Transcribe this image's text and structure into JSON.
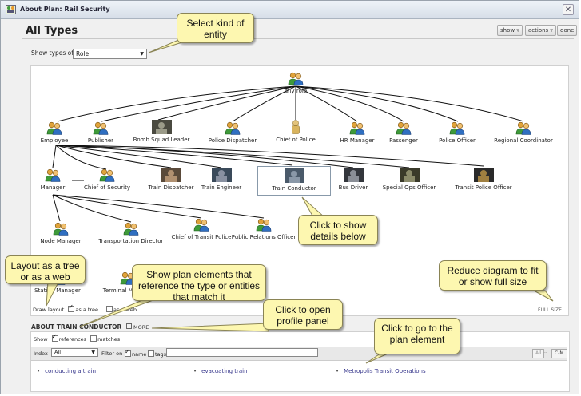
{
  "window": {
    "title": "About Plan: Rail Security",
    "close_glyph": "✕"
  },
  "panel": {
    "title": "All Types"
  },
  "toolbar": {
    "show_label": "show ▿",
    "actions_label": "actions ▿",
    "done_label": "done"
  },
  "types_filter": {
    "label": "Show types of",
    "value": "Role",
    "arrow": "▼"
  },
  "diagram": {
    "nodes": {
      "any_role": "any role",
      "employee": "Employee",
      "publisher": "Publisher",
      "bomb_squad": "Bomb Squad Leader",
      "police_dispatcher": "Police Dispatcher",
      "chief_of_police": "Chief of Police",
      "hr_manager": "HR Manager",
      "passenger": "Passenger",
      "police_officer": "Police Officer",
      "regional_coordinator": "Regional Coordinator",
      "manager": "Manager",
      "chief_of_security": "Chief of Security",
      "train_dispatcher": "Train Dispatcher",
      "train_engineer": "Train Engineer",
      "train_conductor": "Train Conductor",
      "bus_driver": "Bus Driver",
      "special_ops": "Special Ops Officer",
      "transit_police": "Transit Police Officer",
      "node_manager": "Node Manager",
      "transportation_director": "Transportation Director",
      "chief_transit_police": "Chief of Transit Police",
      "public_relations": "Public Relations Officer",
      "station_manager": "Station Manager",
      "terminal_manager": "Terminal Manager"
    },
    "layout_label": "Draw layout",
    "as_tree": "as a tree",
    "as_web": "as a web",
    "full_size": "FULL SIZE"
  },
  "about": {
    "heading": "ABOUT TRAIN CONDUCTOR",
    "more": "MORE",
    "show_label": "Show",
    "references": "references",
    "matches": "matches",
    "index_label": "Index",
    "index_value": "All",
    "filter_label": "Filter on",
    "name_label": "name",
    "tags_label": "tags",
    "filter_input": "",
    "alpha_all": "All",
    "alpha_dash": "--",
    "alpha_range": "C-M",
    "results": [
      "conducting a train",
      "evacuating train",
      "Metropolis Transit Operations"
    ]
  },
  "callouts": {
    "select_kind": "Select kind of entity",
    "click_show": "Click to show details below",
    "layout": "Layout as a tree or as a web",
    "show_plan": "Show plan elements that reference the type or entities that match it",
    "open_profile": "Click to open profile panel",
    "go_plan": "Click to go to the plan element",
    "reduce": "Reduce diagram  to fit or show full size"
  },
  "colors": {
    "callout_bg": "#fdf7b0",
    "link": "#33338a",
    "icon_green": "#3e9a3a",
    "icon_orange": "#e89a2a"
  }
}
